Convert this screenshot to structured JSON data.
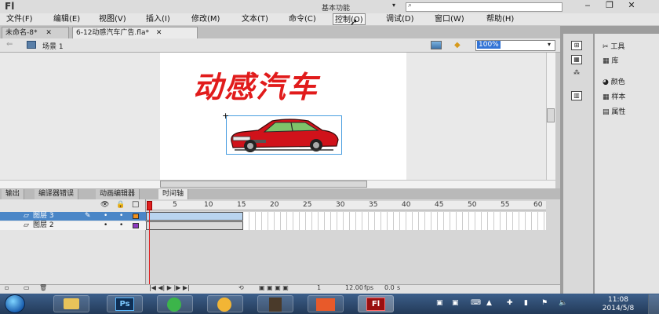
{
  "app": {
    "logo": "Fl",
    "workspace": "基本功能",
    "search_placeholder": ""
  },
  "window_controls": {
    "minimize": "‒",
    "restore": "❐",
    "close": "✕"
  },
  "menu": [
    "文件(F)",
    "编辑(E)",
    "视图(V)",
    "插入(I)",
    "修改(M)",
    "文本(T)",
    "命令(C)",
    "控制(O)",
    "调试(D)",
    "窗口(W)",
    "帮助(H)"
  ],
  "tabs": [
    {
      "label": "未命名-8*",
      "close": "✕"
    },
    {
      "label": "6-12动感汽车广告.fla*",
      "close": "✕"
    }
  ],
  "scene": {
    "label": "场景 1",
    "zoom": "100%"
  },
  "stage": {
    "title_text": "动感汽车"
  },
  "panel_tabs": [
    "输出",
    "编译器错误",
    "动画编辑器",
    "时间轴"
  ],
  "timeline": {
    "header_icons": [
      "👁",
      "🔒",
      "□"
    ],
    "frame_numbers": [
      "1",
      "5",
      "10",
      "15",
      "20",
      "25",
      "30",
      "35",
      "40",
      "45",
      "50",
      "55",
      "60"
    ],
    "layers": [
      {
        "name": "图层 3",
        "selected": true,
        "color": "#f0901c"
      },
      {
        "name": "图层 2",
        "selected": false,
        "color": "#8e3ac0"
      }
    ],
    "current_frame": "1",
    "fps": "12.00",
    "fps_unit": "fps",
    "time": "0.0",
    "time_unit": "s"
  },
  "right_panels": {
    "col2": [
      {
        "icon": "tools-icon",
        "label": "工具"
      },
      {
        "icon": "library-icon",
        "label": "库"
      },
      {
        "icon": "color-icon",
        "label": "颜色"
      },
      {
        "icon": "swatches-icon",
        "label": "样本"
      },
      {
        "icon": "properties-icon",
        "label": "属性"
      }
    ]
  },
  "taskbar": {
    "apps": [
      "Ps",
      "Fl"
    ],
    "time": "11:08",
    "date": "2014/5/8"
  },
  "colors": {
    "accent": "#3374d6",
    "title_red": "#e11b1b",
    "selected_layer": "#4a86c7"
  }
}
